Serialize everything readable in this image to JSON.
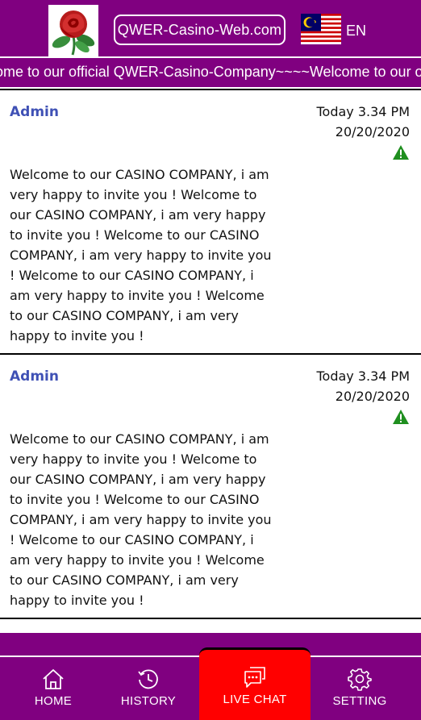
{
  "header": {
    "site_title": "QWER-Casino-Web.com",
    "language": "EN",
    "logo_icon": "rose-icon",
    "flag_icon": "malaysia-flag-icon"
  },
  "marquee": {
    "text": "ome to our official QWER-Casino-Company~~~~Welcome to our official QWER-Casino-Company~~~~"
  },
  "messages": [
    {
      "author": "Admin",
      "time": "Today 3.34 PM",
      "date": "20/20/2020",
      "status_icon": "warning-triangle-icon",
      "body": "Welcome to our CASINO COMPANY, i am very happy to invite you ! Welcome to our CASINO COMPANY, i am very happy to invite you ! Welcome to our CASINO COMPANY, i am very happy to invite you ! Welcome to our CASINO COMPANY, i am very happy to invite you ! Welcome to our CASINO COMPANY, i am very happy to invite you !"
    },
    {
      "author": "Admin",
      "time": "Today 3.34 PM",
      "date": "20/20/2020",
      "status_icon": "warning-triangle-icon",
      "body": "Welcome to our CASINO COMPANY, i am very happy to invite you ! Welcome to our CASINO COMPANY, i am very happy to invite you ! Welcome to our CASINO COMPANY, i am very happy to invite you ! Welcome to our CASINO COMPANY, i am very happy to invite you ! Welcome to our CASINO COMPANY, i am very happy to invite you !"
    }
  ],
  "nav": {
    "home": {
      "label": "HOME",
      "icon": "home-icon"
    },
    "history": {
      "label": "HISTORY",
      "icon": "history-icon"
    },
    "live_chat": {
      "label": "LIVE CHAT",
      "icon": "chat-icon"
    },
    "setting": {
      "label": "SETTING",
      "icon": "gear-icon"
    }
  },
  "colors": {
    "brand_purple": "#800080",
    "active_red": "#ff0000",
    "author_blue": "#3f51b5",
    "warning_green": "#1f8f1f"
  }
}
